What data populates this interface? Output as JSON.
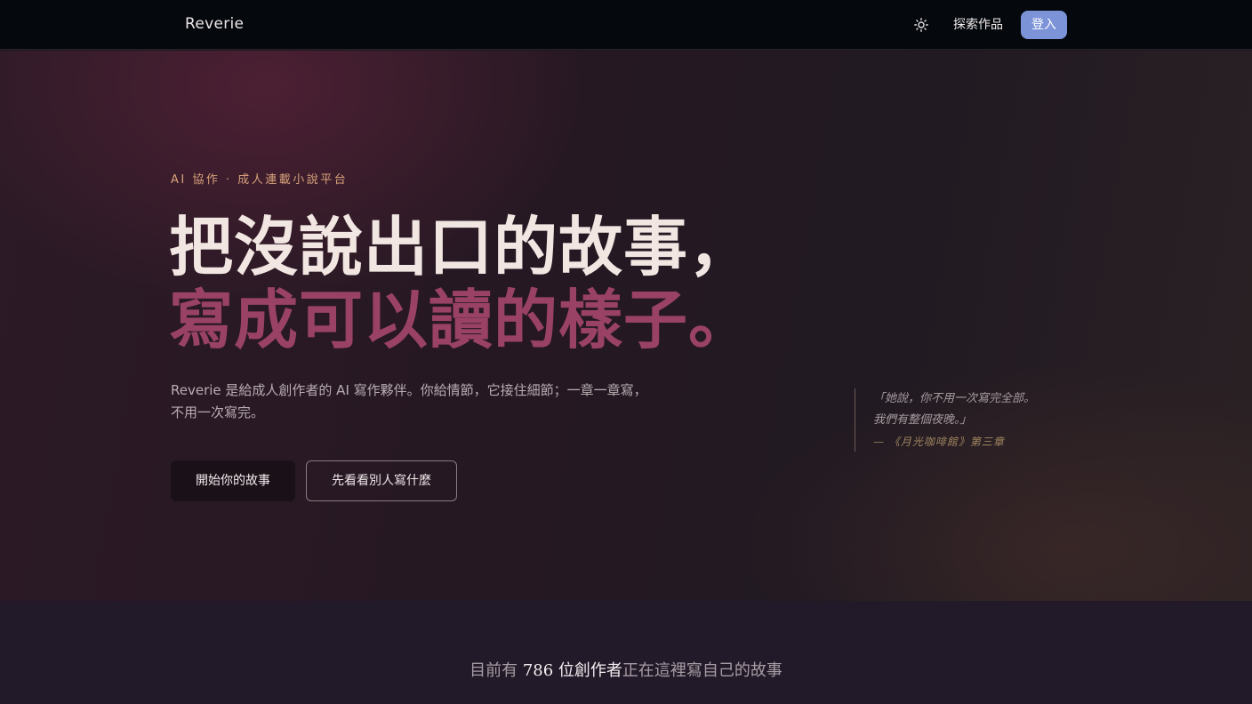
{
  "nav": {
    "brand": "Reverie",
    "theme_icon": "sun-icon",
    "explore_label": "探索作品",
    "login_label": "登入"
  },
  "hero": {
    "eyebrow": "AI 協作 · 成人連載小說平台",
    "headline_line1": "把沒說出口的故事，",
    "headline_line2": "寫成可以讀的樣子。",
    "description_line1": "Reverie 是給成人創作者的 AI 寫作夥伴。你給情節，它接住細節；一章一章寫，",
    "description_line2": "不用一次寫完。",
    "primary_cta": "開始你的故事",
    "secondary_cta": "先看看別人寫什麼",
    "quote": {
      "line1": "「她說，你不用一次寫完全部。",
      "line2": "我們有整個夜晚。」",
      "source": "— 《月光咖啡館》第三章"
    }
  },
  "stats": {
    "prefix": "目前有",
    "count": "786 位創作者",
    "suffix": "正在這裡寫自己的故事"
  },
  "colors": {
    "nav_bg": "#05080c",
    "accent_button": "#7c93d8",
    "eyebrow": "#d8a27a",
    "headline_primary": "#f1e6e2",
    "headline_accent": "#9a4266"
  }
}
